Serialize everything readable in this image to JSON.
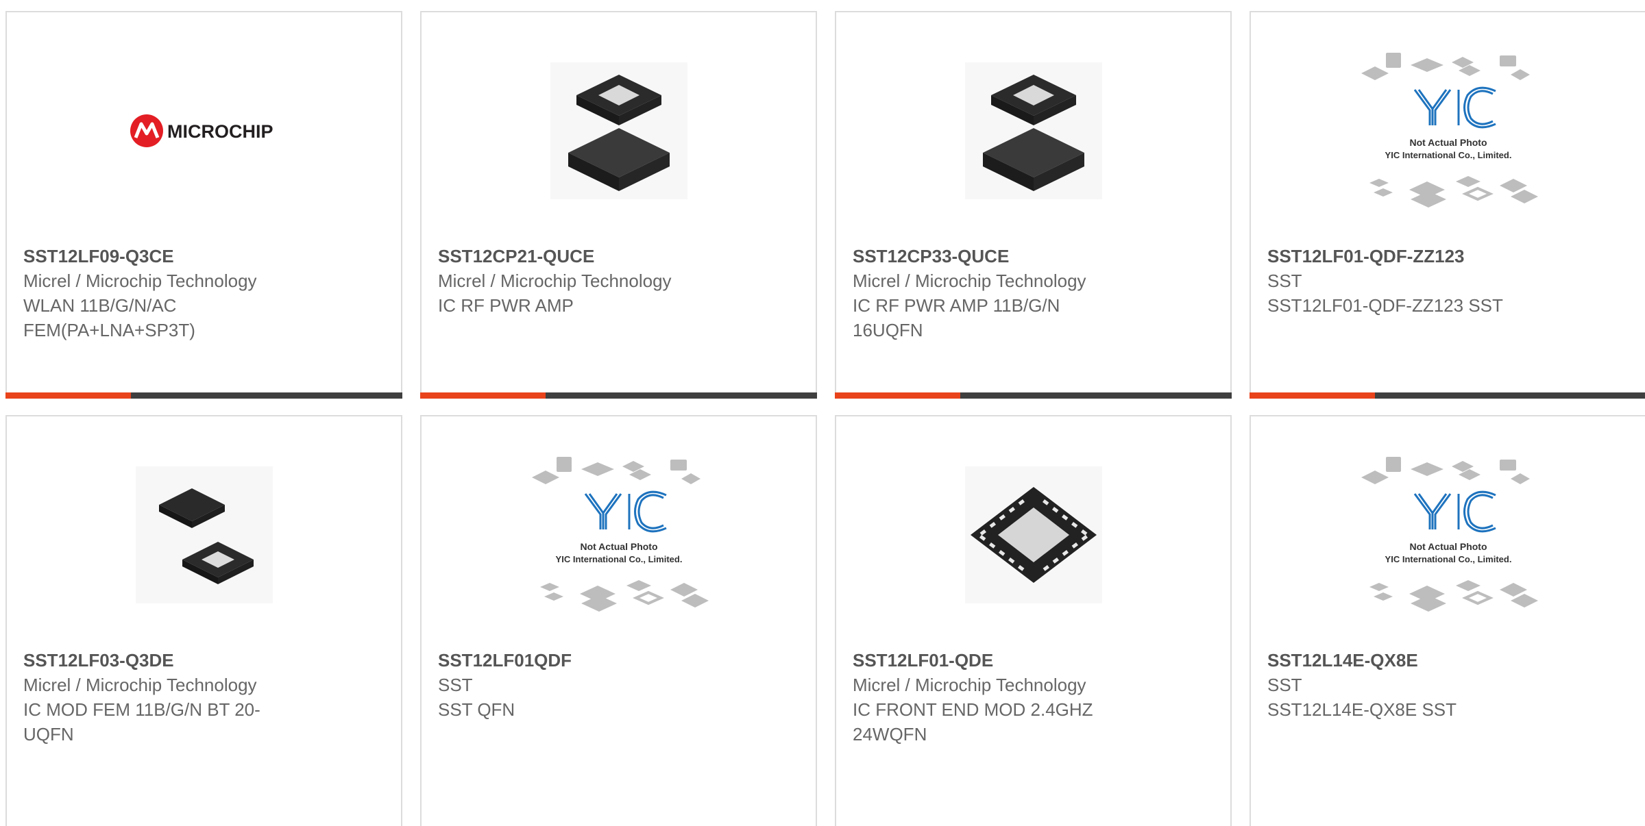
{
  "products": [
    {
      "part_number": "SST12LF09-Q3CE",
      "manufacturer": "Micrel / Microchip Technology",
      "desc_line1": "WLAN 11B/G/N/AC",
      "desc_line2": "FEM(PA+LNA+SP3T)",
      "image": "microchip-logo"
    },
    {
      "part_number": "SST12CP21-QUCE",
      "manufacturer": "Micrel / Microchip Technology",
      "desc_line1": "IC RF PWR AMP",
      "desc_line2": "",
      "image": "qfn-chip-photo"
    },
    {
      "part_number": "SST12CP33-QUCE",
      "manufacturer": "Micrel / Microchip Technology",
      "desc_line1": "IC RF PWR AMP 11B/G/N",
      "desc_line2": "16UQFN",
      "image": "qfn-chip-photo"
    },
    {
      "part_number": "SST12LF01-QDF-ZZ123",
      "manufacturer": "SST",
      "desc_line1": "SST12LF01-QDF-ZZ123 SST",
      "desc_line2": "",
      "image": "not-actual-photo"
    },
    {
      "part_number": "SST12LF03-Q3DE",
      "manufacturer": "Micrel / Microchip Technology",
      "desc_line1": "IC MOD FEM 11B/G/N BT 20-",
      "desc_line2": "UQFN",
      "image": "two-chip-photo"
    },
    {
      "part_number": "SST12LF01QDF",
      "manufacturer": "SST",
      "desc_line1": "SST QFN",
      "desc_line2": "",
      "image": "not-actual-photo"
    },
    {
      "part_number": "SST12LF01-QDE",
      "manufacturer": "Micrel / Microchip Technology",
      "desc_line1": "IC FRONT END MOD 2.4GHZ",
      "desc_line2": "24WQFN",
      "image": "wqfn-chip-photo"
    },
    {
      "part_number": "SST12L14E-QX8E",
      "manufacturer": "SST",
      "desc_line1": "SST12L14E-QX8E SST",
      "desc_line2": "",
      "image": "not-actual-photo"
    }
  ],
  "logo_text": "MICROCHIP",
  "placeholder": {
    "logo": "YIC",
    "line1": "Not Actual Photo",
    "line2": "YIC International Co., Limited."
  },
  "colors": {
    "accent": "#e8431b",
    "bar": "#3f3f3f",
    "card_border": "#dcdcdc",
    "microchip_red": "#e31e24",
    "yic_blue": "#1e73be"
  }
}
